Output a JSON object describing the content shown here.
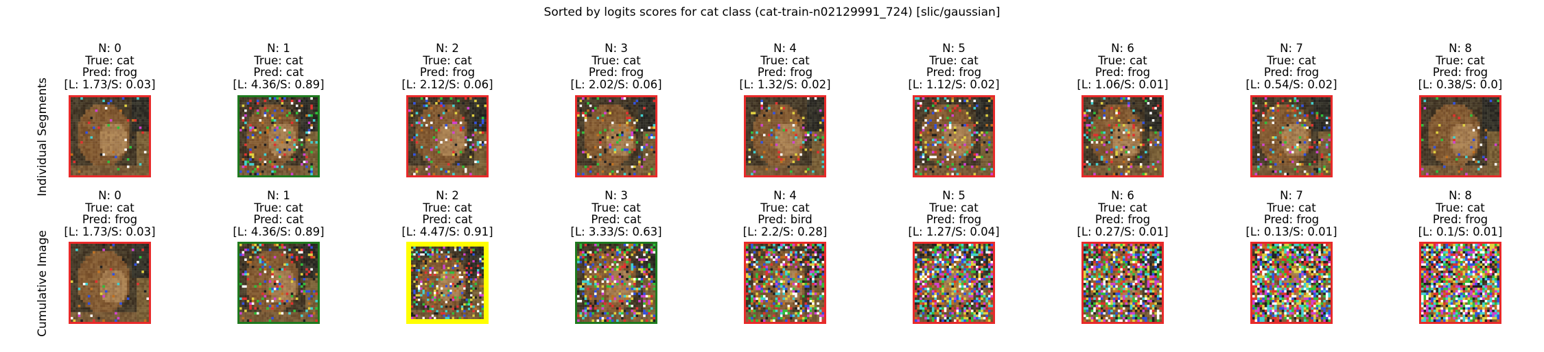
{
  "suptitle": "Sorted by logits scores for cat class (cat-train-n02129991_724) [slic/gaussian]",
  "row_labels": [
    "Individual Segments",
    "Cumulative Image"
  ],
  "border_colors": {
    "red": "#e82a2a",
    "green": "#1f7a1f",
    "yellow": "#ffff00"
  },
  "chart_data": {
    "type": "image-grid",
    "title": "Sorted by logits scores for cat class (cat-train-n02129991_724) [slic/gaussian]",
    "rows": [
      {
        "name": "Individual Segments",
        "cells": [
          {
            "n": "N: 0",
            "true": "True: cat",
            "pred": "Pred: frog",
            "score": "[L: 1.73/S: 0.03]",
            "border": "red",
            "noise": 0.05
          },
          {
            "n": "N: 1",
            "true": "True: cat",
            "pred": "Pred: cat",
            "score": "[L: 4.36/S: 0.89]",
            "border": "green",
            "noise": 0.18
          },
          {
            "n": "N: 2",
            "true": "True: cat",
            "pred": "Pred: frog",
            "score": "[L: 2.12/S: 0.06]",
            "border": "red",
            "noise": 0.14
          },
          {
            "n": "N: 3",
            "true": "True: cat",
            "pred": "Pred: frog",
            "score": "[L: 2.02/S: 0.06]",
            "border": "red",
            "noise": 0.14
          },
          {
            "n": "N: 4",
            "true": "True: cat",
            "pred": "Pred: frog",
            "score": "[L: 1.32/S: 0.02]",
            "border": "red",
            "noise": 0.12
          },
          {
            "n": "N: 5",
            "true": "True: cat",
            "pred": "Pred: frog",
            "score": "[L: 1.12/S: 0.02]",
            "border": "red",
            "noise": 0.2
          },
          {
            "n": "N: 6",
            "true": "True: cat",
            "pred": "Pred: frog",
            "score": "[L: 1.06/S: 0.01]",
            "border": "red",
            "noise": 0.16
          },
          {
            "n": "N: 7",
            "true": "True: cat",
            "pred": "Pred: frog",
            "score": "[L: 0.54/S: 0.02]",
            "border": "red",
            "noise": 0.16
          },
          {
            "n": "N: 8",
            "true": "True: cat",
            "pred": "Pred: frog",
            "score": "[L: 0.38/S: 0.0]",
            "border": "red",
            "noise": 0.05
          }
        ]
      },
      {
        "name": "Cumulative Image",
        "cells": [
          {
            "n": "N: 0",
            "true": "True: cat",
            "pred": "Pred: frog",
            "score": "[L: 1.73/S: 0.03]",
            "border": "red",
            "noise": 0.05
          },
          {
            "n": "N: 1",
            "true": "True: cat",
            "pred": "Pred: cat",
            "score": "[L: 4.36/S: 0.89]",
            "border": "green",
            "noise": 0.18
          },
          {
            "n": "N: 2",
            "true": "True: cat",
            "pred": "Pred: cat",
            "score": "[L: 4.47/S: 0.91]",
            "border": "yellow",
            "noise": 0.28
          },
          {
            "n": "N: 3",
            "true": "True: cat",
            "pred": "Pred: cat",
            "score": "[L: 3.33/S: 0.63]",
            "border": "green",
            "noise": 0.38
          },
          {
            "n": "N: 4",
            "true": "True: cat",
            "pred": "Pred: bird",
            "score": "[L: 2.2/S: 0.28]",
            "border": "red",
            "noise": 0.48
          },
          {
            "n": "N: 5",
            "true": "True: cat",
            "pred": "Pred: frog",
            "score": "[L: 1.27/S: 0.04]",
            "border": "red",
            "noise": 0.6
          },
          {
            "n": "N: 6",
            "true": "True: cat",
            "pred": "Pred: frog",
            "score": "[L: 0.27/S: 0.01]",
            "border": "red",
            "noise": 0.7
          },
          {
            "n": "N: 7",
            "true": "True: cat",
            "pred": "Pred: frog",
            "score": "[L: 0.13/S: 0.01]",
            "border": "red",
            "noise": 0.82
          },
          {
            "n": "N: 8",
            "true": "True: cat",
            "pred": "Pred: frog",
            "score": "[L: 0.1/S: 0.01]",
            "border": "red",
            "noise": 0.9
          }
        ]
      }
    ]
  }
}
